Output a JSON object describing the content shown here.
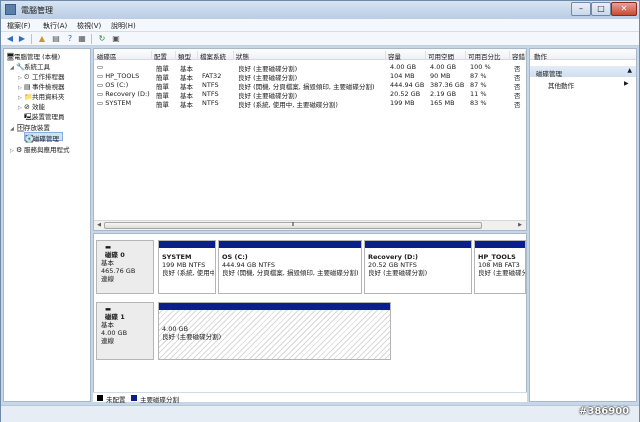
{
  "window": {
    "title": "電腦管理"
  },
  "menu": [
    "檔案(F)",
    "執行(A)",
    "檢視(V)",
    "說明(H)"
  ],
  "tree": [
    {
      "label": "電腦管理 (本機)",
      "indent": 0,
      "icon": "computer-icon",
      "expanded": true
    },
    {
      "label": "系統工具",
      "indent": 1,
      "icon": "tools-icon",
      "expanded": true
    },
    {
      "label": "工作排程器",
      "indent": 2,
      "icon": "clock-icon",
      "expanded": false
    },
    {
      "label": "事件檢視器",
      "indent": 2,
      "icon": "event-viewer-icon",
      "expanded": false
    },
    {
      "label": "共用資料夾",
      "indent": 2,
      "icon": "shared-folder-icon",
      "expanded": false
    },
    {
      "label": "效能",
      "indent": 2,
      "icon": "performance-icon",
      "expanded": false
    },
    {
      "label": "裝置管理員",
      "indent": 2,
      "icon": "device-manager-icon",
      "expanded": null
    },
    {
      "label": "存放裝置",
      "indent": 1,
      "icon": "storage-icon",
      "expanded": true
    },
    {
      "label": "磁碟管理",
      "indent": 2,
      "icon": "disk-management-icon",
      "expanded": null,
      "selected": true
    },
    {
      "label": "服務與應用程式",
      "indent": 1,
      "icon": "services-icon",
      "expanded": false
    }
  ],
  "volume_list": {
    "columns": [
      "磁碟區",
      "配置",
      "類型",
      "檔案系統",
      "狀態",
      "容量",
      "可用空間",
      "可用百分比",
      "容錯",
      "額外負荷"
    ],
    "rows": [
      [
        "",
        "簡單",
        "基本",
        "",
        "良好 (主要磁碟分割)",
        "4.00 GB",
        "4.00 GB",
        "100 %",
        "否",
        "0%"
      ],
      [
        "HP_TOOLS",
        "簡單",
        "基本",
        "FAT32",
        "良好 (主要磁碟分割)",
        "104 MB",
        "90 MB",
        "87 %",
        "否",
        "0%"
      ],
      [
        "OS (C:)",
        "簡單",
        "基本",
        "NTFS",
        "良好 (開機, 分頁檔案, 損毀傾印, 主要磁碟分割)",
        "444.94 GB",
        "387.36 GB",
        "87 %",
        "否",
        "0%"
      ],
      [
        "Recovery (D:)",
        "簡單",
        "基本",
        "NTFS",
        "良好 (主要磁碟分割)",
        "20.52 GB",
        "2.19 GB",
        "11 %",
        "否",
        "0%"
      ],
      [
        "SYSTEM",
        "簡單",
        "基本",
        "NTFS",
        "良好 (系統, 使用中, 主要磁碟分割)",
        "199 MB",
        "165 MB",
        "83 %",
        "否",
        "0%"
      ]
    ]
  },
  "disks": [
    {
      "name": "磁碟 0",
      "type": "基本",
      "size": "465.76 GB",
      "status": "連線",
      "partitions": [
        {
          "name": "SYSTEM",
          "size": "199 MB NTFS",
          "status": "良好 (系統, 使用中, 主要磁碟分割)"
        },
        {
          "name": "OS  (C:)",
          "size": "444.94 GB NTFS",
          "status": "良好 (開機, 分頁檔案, 損毀傾印, 主要磁碟分割)"
        },
        {
          "name": "Recovery  (D:)",
          "size": "20.52 GB NTFS",
          "status": "良好 (主要磁碟分割)"
        },
        {
          "name": "HP_TOOLS",
          "size": "108 MB FAT3",
          "status": "良好 (主要磁碟分割)"
        }
      ]
    },
    {
      "name": "磁碟 1",
      "type": "基本",
      "size": "4.00 GB",
      "status": "連線",
      "partitions": [
        {
          "name": "",
          "size": "4.00 GB",
          "status": "良好 (主要磁碟分割)"
        }
      ]
    }
  ],
  "legend": [
    {
      "label": "未配置",
      "color": "#000000"
    },
    {
      "label": "主要磁碟分割",
      "color": "#0a1e8c"
    }
  ],
  "actions": {
    "header": "動作",
    "section": "磁碟管理",
    "items": [
      "其他動作"
    ]
  },
  "watermark": "#386900"
}
